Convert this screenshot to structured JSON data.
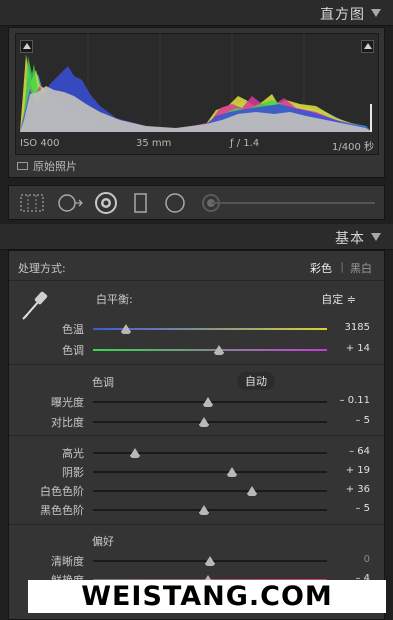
{
  "histogram": {
    "header_title": "直方图",
    "iso": "ISO 400",
    "focal": "35 mm",
    "aperture": "ƒ / 1.4",
    "shutter": "1/400 秒",
    "original_photo_label": "原始照片"
  },
  "basic": {
    "header_title": "基本",
    "treatment_label": "处理方式:",
    "treatment_color": "彩色",
    "treatment_separator": "|",
    "treatment_bw": "黑白",
    "wb_label": "白平衡:",
    "wb_value": "自定 ≑",
    "temp": {
      "label": "色温",
      "value": "3185",
      "level": 0.14
    },
    "tint": {
      "label": "色调",
      "value": "+ 14",
      "level": 0.54
    },
    "tone_label": "色调",
    "auto_label": "自动",
    "exposure": {
      "label": "曝光度",
      "value": "– 0.11",
      "level": 0.49
    },
    "contrast": {
      "label": "对比度",
      "value": "– 5",
      "level": 0.475
    },
    "highlights": {
      "label": "高光",
      "value": "– 64",
      "level": 0.18
    },
    "shadows": {
      "label": "阴影",
      "value": "+ 19",
      "level": 0.595
    },
    "whites": {
      "label": "白色色阶",
      "value": "+ 36",
      "level": 0.68
    },
    "blacks": {
      "label": "黑色色阶",
      "value": "– 5",
      "level": 0.475
    },
    "presence_label": "偏好",
    "clarity": {
      "label": "清晰度",
      "value": "0",
      "level": 0.5
    },
    "vibrance": {
      "label": "鲜艳度",
      "value": "– 4",
      "level": 0.49
    }
  },
  "watermark": "WEISTANG.COM",
  "colors": {
    "temp_track_start": "#3a5ad8",
    "temp_track_end": "#d8d23a",
    "tint_track_start": "#3ad84a",
    "tint_track_end": "#c83ad8"
  }
}
